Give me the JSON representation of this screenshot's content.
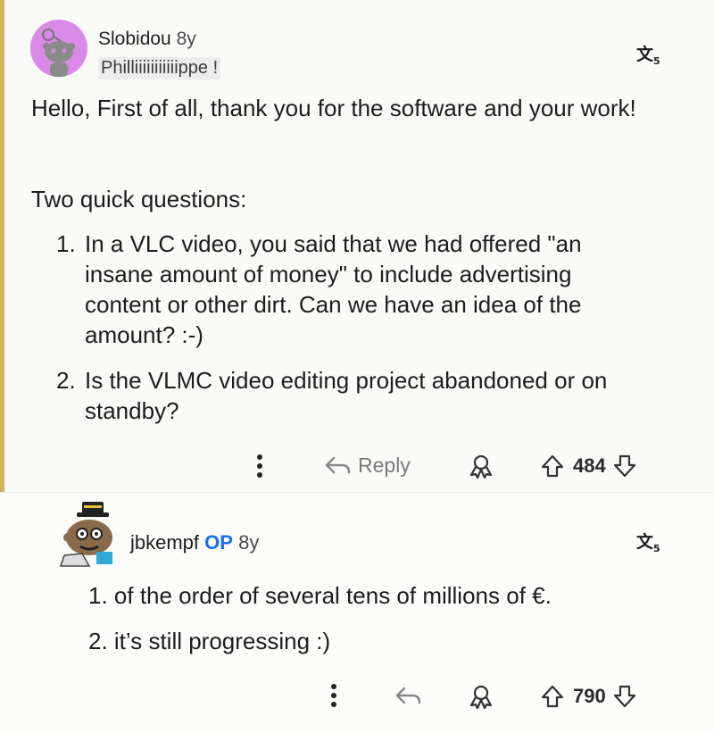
{
  "comment1": {
    "author": "Slobidou",
    "age": "8y",
    "flair": "Philliiiiiiiiiiippe !",
    "intro": "Hello, First of all, thank you for the software and your work!",
    "subhead": "Two quick questions:",
    "list": [
      {
        "num": "1.",
        "text": "In a VLC video, you said that we had offered \"an insane amount of money\" to include advertising content or other dirt. Can we have an idea of the amount? :-)"
      },
      {
        "num": "2.",
        "text": "Is the VLMC video editing project abandoned or on standby?"
      }
    ],
    "reply_label": "Reply",
    "votes": "484"
  },
  "comment2": {
    "author": "jbkempf",
    "op_tag": "OP",
    "age": "8y",
    "lines": [
      "1. of the order of several tens of millions of €.",
      "2. it’s still progressing :)"
    ],
    "votes": "790"
  },
  "icons": {
    "translate": "translate-icon",
    "more": "more-vertical-icon",
    "reply": "reply-arrow-icon",
    "award": "award-icon",
    "upvote": "upvote-arrow-icon",
    "downvote": "downvote-arrow-icon"
  },
  "colors": {
    "accent": "#d8b25a",
    "op": "#1a6ef0",
    "avatar1_bg": "#d98ae6"
  }
}
